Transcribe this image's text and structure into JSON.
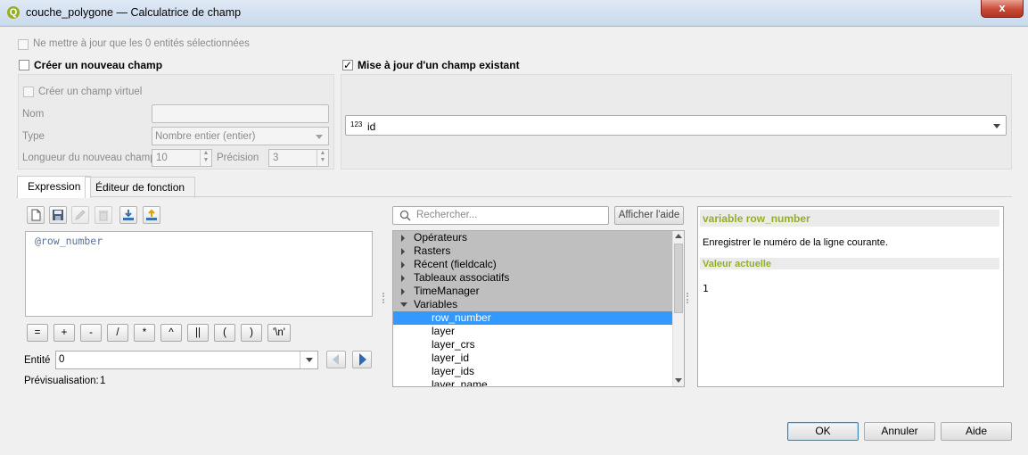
{
  "window": {
    "title": "couche_polygone — Calculatrice de champ",
    "app_icon": "qgis-icon",
    "close_label": "x"
  },
  "only_selected": {
    "label": "Ne mettre à jour que les 0 entités sélectionnées",
    "checked": false
  },
  "new_field": {
    "label": "Créer un nouveau champ",
    "checked": false,
    "virtual_label": "Créer un champ virtuel",
    "name_label": "Nom",
    "name_value": "",
    "type_label": "Type",
    "type_value": "Nombre entier (entier)",
    "length_label": "Longueur du nouveau champ",
    "length_value": "10",
    "precision_label": "Précision",
    "precision_value": "3"
  },
  "update_field": {
    "label": "Mise à jour d'un champ existant",
    "checked": true,
    "type_badge": "123",
    "field_value": "id"
  },
  "tabs": [
    {
      "label": "Expression",
      "active": true
    },
    {
      "label": "Éditeur de fonction",
      "active": false
    }
  ],
  "toolbar": {
    "icons": [
      "new-file-icon",
      "save-icon",
      "edit-icon",
      "delete-icon",
      "import-icon",
      "export-icon"
    ]
  },
  "expression": {
    "text": "@row_number"
  },
  "operators": [
    "=",
    "+",
    "-",
    "/",
    "*",
    "^",
    "||",
    "(",
    ")",
    "'\\n'"
  ],
  "entity": {
    "label": "Entité",
    "value": "0"
  },
  "preview": {
    "label": "Prévisualisation:",
    "value": "1"
  },
  "search": {
    "placeholder": "Rechercher...",
    "help_button": "Afficher l'aide"
  },
  "tree": {
    "groups": [
      "Opérateurs",
      "Rasters",
      "Récent (fieldcalc)",
      "Tableaux associatifs",
      "TimeManager",
      "Variables"
    ],
    "variables": [
      "row_number",
      "layer",
      "layer_crs",
      "layer_id",
      "layer_ids",
      "layer_name"
    ],
    "selected": "row_number"
  },
  "help": {
    "title": "variable row_number",
    "description": "Enregistrer le numéro de la ligne courante.",
    "current_value_label": "Valeur actuelle",
    "current_value": "1",
    "accent_color": "#93b023"
  },
  "buttons": {
    "ok": "OK",
    "cancel": "Annuler",
    "help": "Aide"
  }
}
